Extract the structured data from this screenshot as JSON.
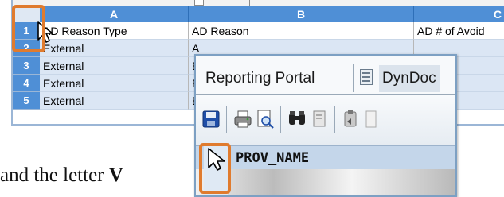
{
  "spreadsheet": {
    "columns": [
      "A",
      "B",
      "C"
    ],
    "rows": [
      {
        "num": "1",
        "a": "AD Reason Type",
        "b": "AD Reason",
        "c": "AD # of Avoid"
      },
      {
        "num": "2",
        "a": "External",
        "b": "A",
        "c": ""
      },
      {
        "num": "3",
        "a": "External",
        "b": "E",
        "c": ""
      },
      {
        "num": "4",
        "a": "External",
        "b": "E",
        "c": ""
      },
      {
        "num": "5",
        "a": "External",
        "b": "E",
        "c": ""
      }
    ]
  },
  "caption": {
    "text": "and the letter ",
    "bold": "V"
  },
  "portal": {
    "tab_active": "Reporting Portal",
    "tab_second": "DynDoc",
    "column_header": "PROV_NAME",
    "toolbar_icons": [
      "save-icon",
      "print-icon",
      "print-preview-icon",
      "find-icon",
      "copy-icon",
      "paste-icon"
    ]
  },
  "colors": {
    "highlight": "#e07b2e",
    "header_blue": "#4f8fd6",
    "row_alt": "#dbe6f4"
  }
}
